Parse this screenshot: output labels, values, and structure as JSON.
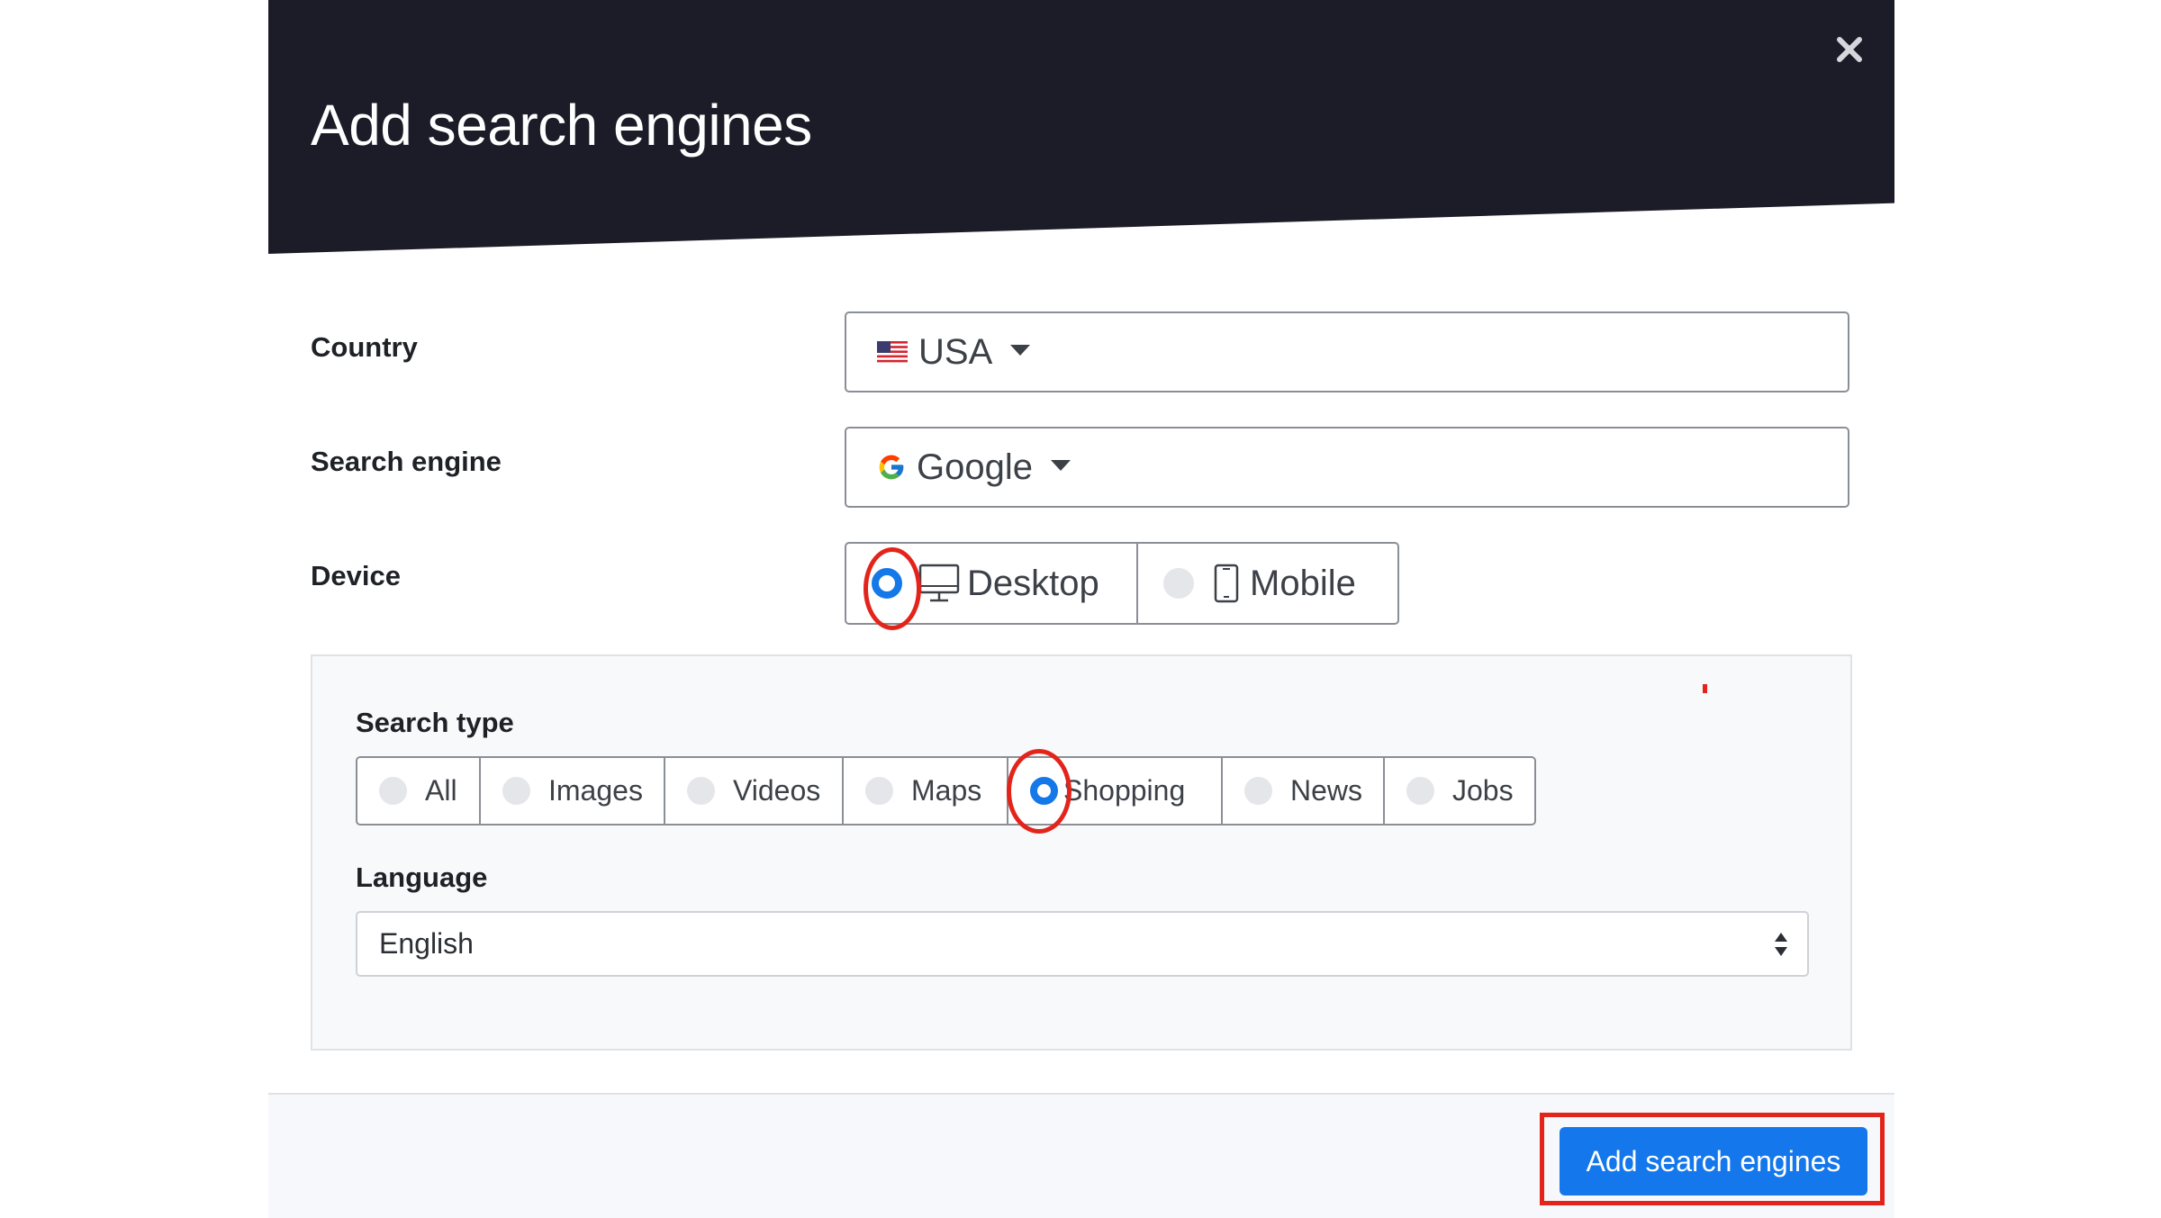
{
  "modal": {
    "title": "Add search engines",
    "close_icon": "close-icon"
  },
  "form": {
    "country": {
      "label": "Country",
      "value": "USA",
      "icon": "us-flag-icon"
    },
    "search_engine": {
      "label": "Search engine",
      "value": "Google",
      "icon": "google-logo-icon"
    },
    "device": {
      "label": "Device",
      "options": [
        {
          "label": "Desktop",
          "icon": "desktop-monitor-icon",
          "selected": true
        },
        {
          "label": "Mobile",
          "icon": "mobile-phone-icon",
          "selected": false
        }
      ]
    },
    "search_type": {
      "label": "Search type",
      "options": [
        {
          "label": "All",
          "selected": false
        },
        {
          "label": "Images",
          "selected": false
        },
        {
          "label": "Videos",
          "selected": false
        },
        {
          "label": "Maps",
          "selected": false
        },
        {
          "label": "Shopping",
          "selected": true
        },
        {
          "label": "News",
          "selected": false
        },
        {
          "label": "Jobs",
          "selected": false
        }
      ]
    },
    "language": {
      "label": "Language",
      "value": "English"
    }
  },
  "footer": {
    "submit_label": "Add search engines"
  },
  "colors": {
    "header_bg": "#1b1c27",
    "accent": "#1478e8",
    "annotation": "#e3241b"
  }
}
